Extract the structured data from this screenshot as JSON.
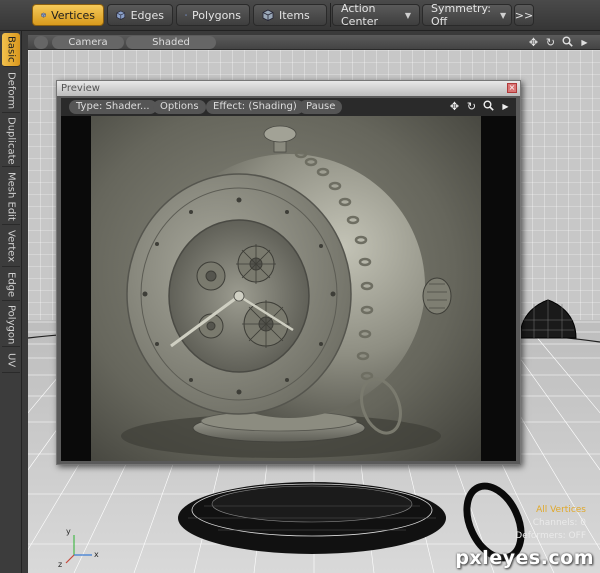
{
  "toolbar": {
    "mode_buttons": [
      {
        "label": "Vertices",
        "active": true
      },
      {
        "label": "Edges",
        "active": false
      },
      {
        "label": "Polygons",
        "active": false
      },
      {
        "label": "Items",
        "active": false
      }
    ],
    "action_center": "Action Center",
    "symmetry": "Symmetry: Off",
    "overflow": ">>"
  },
  "left_tabs": [
    "Basic",
    "Deform",
    "Duplicate",
    "Mesh Edit",
    "Vertex",
    "Edge",
    "Polygon",
    "UV"
  ],
  "viewport": {
    "camera_label": "Camera",
    "shading_label": "Shaded",
    "axis_labels": {
      "x": "x",
      "y": "y",
      "z": "z"
    }
  },
  "preview": {
    "title": "Preview",
    "close_glyph": "×",
    "toolbar": {
      "type": "Type: Shader...",
      "options": "Options",
      "effect": "Effect: (Shading)",
      "pause": "Pause"
    }
  },
  "status": {
    "line1": "All Vertices",
    "line2": "Channels: 0",
    "line3": "Deformers: OFF"
  },
  "watermark": "pxleyes.com",
  "colors": {
    "accent": "#e6ad2e",
    "toolbar_bg": "#3c3c3c",
    "viewport_bg": "#cfcfcf",
    "render_bg": "#0a0a0a"
  },
  "icons": {
    "move": "move-icon",
    "rotate": "rotate-icon",
    "zoom": "zoom-icon",
    "menu": "triangle-menu-icon"
  }
}
